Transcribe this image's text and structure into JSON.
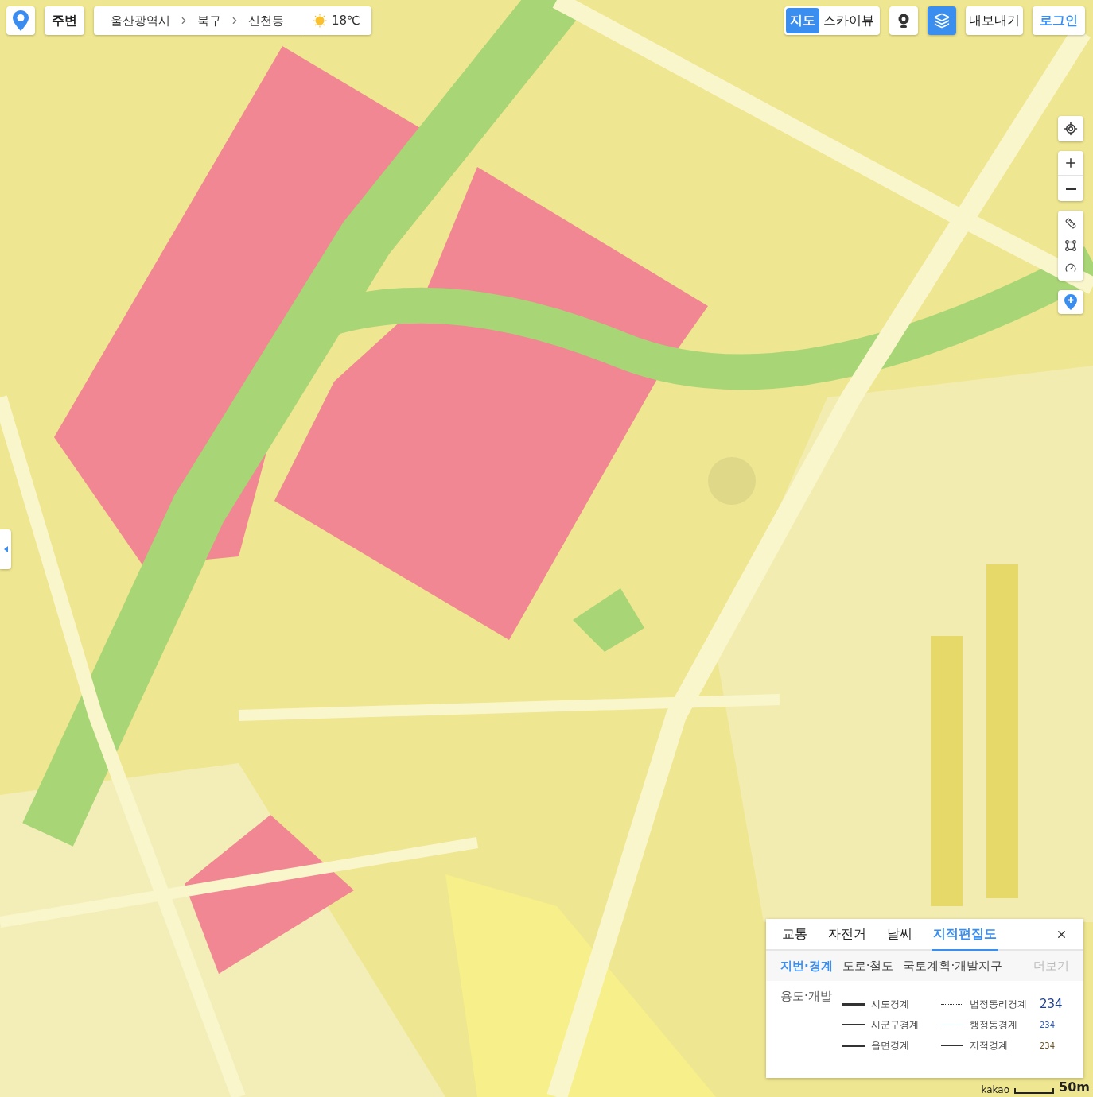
{
  "nearby_button": "주변",
  "location_bar": {
    "breadcrumb": [
      "울산광역시",
      "북구",
      "신천동"
    ],
    "weather": "18℃"
  },
  "map_types": [
    {
      "label": "지도",
      "selected": true
    },
    {
      "label": "스카이뷰",
      "selected": false
    }
  ],
  "layers_button": {
    "selected": true
  },
  "export_button": "내보내기",
  "login_link": "로그인",
  "legend_panel": {
    "tabs": [
      {
        "label": "교통",
        "selected": false
      },
      {
        "label": "자전거",
        "selected": false
      },
      {
        "label": "날씨",
        "selected": false
      },
      {
        "label": "지적편집도",
        "selected": true
      }
    ],
    "subtabs": [
      {
        "label": "지번·경계",
        "selected": true
      },
      {
        "label": "도로·철도",
        "selected": false
      },
      {
        "label": "국토계획·개발지구",
        "selected": false
      }
    ],
    "more": "더보기",
    "section_title": "용도·개발",
    "boundaries": [
      {
        "label": "시도경계",
        "kind": "thick",
        "color": "#333333"
      },
      {
        "label": "시군구경계",
        "kind": "thin",
        "color": "#333333"
      },
      {
        "label": "읍면경계",
        "kind": "thick",
        "color": "#333333"
      },
      {
        "label": "법정동리경계",
        "kind": "dotted",
        "color": "#333333"
      },
      {
        "label": "행정동경계",
        "kind": "dotted",
        "color": "#1d4fa8"
      },
      {
        "label": "지적경계",
        "kind": "thin",
        "color": "#333333"
      }
    ],
    "samples": [
      {
        "text": "234",
        "kind": "large",
        "color": "#1d3f8f"
      },
      {
        "text": "234",
        "kind": "small",
        "color": "#2a5cc4"
      },
      {
        "text": "234",
        "kind": "small",
        "color": "#6b5320"
      }
    ]
  },
  "scale": {
    "brand": "kakao",
    "distance": "50m"
  }
}
